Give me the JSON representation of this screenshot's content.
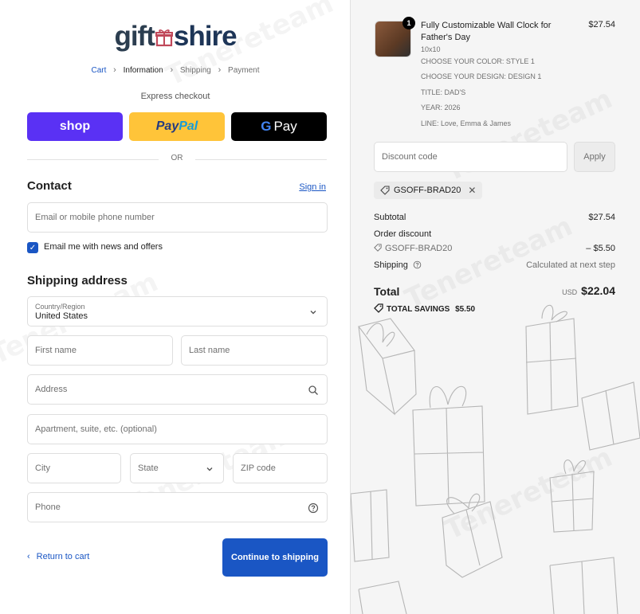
{
  "brand": {
    "logo_gift": "gift",
    "logo_shire": "shire"
  },
  "breadcrumbs": [
    "Cart",
    "Information",
    "Shipping",
    "Payment"
  ],
  "express": {
    "label": "Express checkout",
    "shop": "shop",
    "paypal_pay": "Pay",
    "paypal_pal": "Pal",
    "gpay_g": "G",
    "gpay_pay": "Pay",
    "or": "OR"
  },
  "contact": {
    "heading": "Contact",
    "signin": "Sign in",
    "email_placeholder": "Email or mobile phone number",
    "newsletter": "Email me with news and offers",
    "newsletter_checked": true
  },
  "shipping": {
    "heading": "Shipping address",
    "country_label": "Country/Region",
    "country_value": "United States",
    "first_name": "First name",
    "last_name": "Last name",
    "address": "Address",
    "apartment": "Apartment, suite, etc. (optional)",
    "city": "City",
    "state": "State",
    "zip": "ZIP code",
    "phone": "Phone"
  },
  "actions": {
    "return": "Return to cart",
    "continue": "Continue to shipping"
  },
  "order": {
    "quantity": "1",
    "product_title": "Fully Customizable Wall Clock for Father's Day",
    "price": "$27.54",
    "options": [
      "10x10",
      "CHOOSE YOUR COLOR: STYLE 1",
      "CHOOSE YOUR DESIGN: DESIGN 1",
      "TITLE: DAD'S",
      "YEAR: 2026",
      "LINE: Love, Emma & James"
    ],
    "discount_placeholder": "Discount code",
    "apply": "Apply",
    "code": "GSOFF-BRAD20",
    "subtotal_label": "Subtotal",
    "subtotal": "$27.54",
    "order_discount_label": "Order discount",
    "discount_code": "GSOFF-BRAD20",
    "discount_amount": "– $5.50",
    "shipping_label": "Shipping",
    "shipping_value": "Calculated at next step",
    "total_label": "Total",
    "currency": "USD",
    "total": "$22.04",
    "savings_label": "TOTAL SAVINGS",
    "savings": "$5.50"
  },
  "watermark": "Tenereteam",
  "colors": {
    "accent": "#1a56c4",
    "shop": "#5a31f4",
    "paypal": "#ffc439",
    "gpay": "#000000"
  }
}
